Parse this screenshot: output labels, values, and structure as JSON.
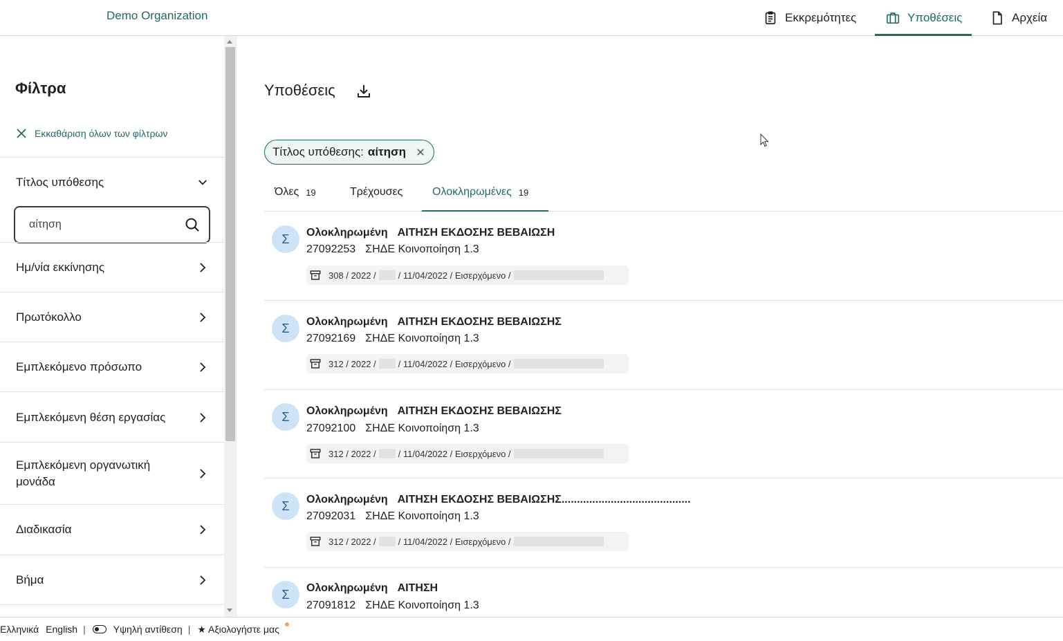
{
  "header": {
    "org_name": "Demo Organization",
    "nav": [
      {
        "label": "Εκκρεμότητες",
        "icon": "clipboard-icon",
        "active": false
      },
      {
        "label": "Υποθέσεις",
        "icon": "briefcase-icon",
        "active": true
      },
      {
        "label": "Αρχεία",
        "icon": "document-icon",
        "active": false
      }
    ]
  },
  "sidebar": {
    "title": "Φίλτρα",
    "clear_all": "Εκκαθάριση όλων των φίλτρων",
    "case_title_filter": {
      "label": "Τίτλος υπόθεσης",
      "value": "αίτηση"
    },
    "filters": [
      {
        "label": "Ημ/νία εκκίνησης"
      },
      {
        "label": "Πρωτόκολλο"
      },
      {
        "label": "Εμπλεκόμενο πρόσωπο"
      },
      {
        "label": "Εμπλεκόμενη θέση εργασίας"
      },
      {
        "label": "Εμπλεκόμενη οργανωτική μονάδα"
      },
      {
        "label": "Διαδικασία"
      },
      {
        "label": "Βήμα"
      }
    ]
  },
  "main": {
    "title": "Υποθέσεις",
    "active_filter_chip": {
      "label": "Τίτλος υπόθεσης:",
      "value": "αίτηση"
    },
    "tabs": [
      {
        "label": "Όλες",
        "count": "19"
      },
      {
        "label": "Τρέχουσες",
        "count": ""
      },
      {
        "label": "Ολοκληρωμένες",
        "count": "19"
      }
    ],
    "cases": [
      {
        "status": "Ολοκληρωμένη",
        "title": "ΑΙΤΗΣΗ ΕΚΔΟΣΗΣ ΒΕΒΑΙΩΣΗ",
        "number": "27092253",
        "process": "ΣΗΔΕ Κοινοποίηση 1.3",
        "meta_a": "308 / 2022 /",
        "meta_b": "/ 11/04/2022 / Εισερχόμενο /",
        "avatar": "Σ"
      },
      {
        "status": "Ολοκληρωμένη",
        "title": "ΑΙΤΗΣΗ ΕΚΔΟΣΗΣ ΒΕΒΑΙΩΣΗΣ",
        "number": "27092169",
        "process": "ΣΗΔΕ Κοινοποίηση 1.3",
        "meta_a": "312 / 2022 /",
        "meta_b": "/ 11/04/2022 / Εισερχόμενο /",
        "avatar": "Σ"
      },
      {
        "status": "Ολοκληρωμένη",
        "title": "ΑΙΤΗΣΗ ΕΚΔΟΣΗΣ ΒΕΒΑΙΩΣΗΣ",
        "number": "27092100",
        "process": "ΣΗΔΕ Κοινοποίηση 1.3",
        "meta_a": "312 / 2022 /",
        "meta_b": "/ 11/04/2022 / Εισερχόμενο /",
        "avatar": "Σ"
      },
      {
        "status": "Ολοκληρωμένη",
        "title": "ΑΙΤΗΣΗ ΕΚΔΟΣΗΣ ΒΕΒΑΙΩΣΗΣ..........................................",
        "number": "27092031",
        "process": "ΣΗΔΕ Κοινοποίηση 1.3",
        "meta_a": "312 / 2022 /",
        "meta_b": "/ 11/04/2022 / Εισερχόμενο /",
        "avatar": "Σ"
      },
      {
        "status": "Ολοκληρωμένη",
        "title": "ΑΙΤΗΣΗ",
        "number": "27091812",
        "process": "ΣΗΔΕ Κοινοποίηση 1.3",
        "avatar": "Σ"
      }
    ]
  },
  "footer": {
    "lang_el": "Ελληνικά",
    "lang_en": "English",
    "sep": "|",
    "high_contrast": "Υψηλή αντίθεση",
    "rate_us": "★ Αξιολογήστε μας"
  },
  "colors": {
    "accent": "#1e6b63",
    "avatar_bg": "#cfe3f7",
    "chip_bg": "#eef6f5"
  }
}
